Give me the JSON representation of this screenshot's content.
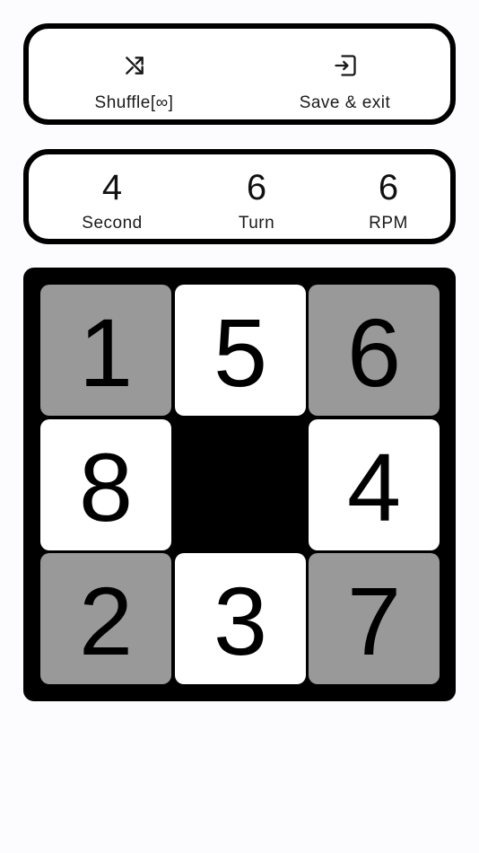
{
  "actions": {
    "shuffle": {
      "label": "Shuffle[∞]",
      "icon": "shuffle-icon"
    },
    "save_exit": {
      "label": "Save & exit",
      "icon": "exit-to-app-icon"
    }
  },
  "stats": [
    {
      "value": "4",
      "name": "Second"
    },
    {
      "value": "6",
      "name": "Turn"
    },
    {
      "value": "6",
      "name": "RPM"
    }
  ],
  "board": {
    "size": 3,
    "tiles": [
      {
        "number": "1",
        "color": "gray"
      },
      {
        "number": "5",
        "color": "white"
      },
      {
        "number": "6",
        "color": "gray"
      },
      {
        "number": "8",
        "color": "white"
      },
      {
        "number": "",
        "color": "blank"
      },
      {
        "number": "4",
        "color": "white"
      },
      {
        "number": "2",
        "color": "gray"
      },
      {
        "number": "3",
        "color": "white"
      },
      {
        "number": "7",
        "color": "gray"
      }
    ],
    "colors": {
      "board": "#000000",
      "white_tile": "#ffffff",
      "gray_tile": "#999999"
    }
  }
}
